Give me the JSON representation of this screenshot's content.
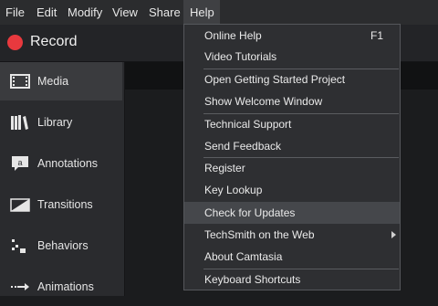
{
  "menubar": {
    "file": "File",
    "edit": "Edit",
    "modify": "Modify",
    "view": "View",
    "share": "Share",
    "help": "Help"
  },
  "toolbar": {
    "record_label": "Record"
  },
  "sidebar": {
    "items": [
      {
        "label": "Media",
        "icon": "film-icon"
      },
      {
        "label": "Library",
        "icon": "books-icon"
      },
      {
        "label": "Annotations",
        "icon": "annotation-icon"
      },
      {
        "label": "Transitions",
        "icon": "transition-icon"
      },
      {
        "label": "Behaviors",
        "icon": "behaviors-icon"
      },
      {
        "label": "Animations",
        "icon": "animation-arrow-icon"
      }
    ]
  },
  "help_menu": {
    "items": [
      {
        "label": "Online Help",
        "shortcut": "F1"
      },
      {
        "label": "Video Tutorials"
      },
      {
        "label": "Open Getting Started Project"
      },
      {
        "label": "Show Welcome Window"
      },
      {
        "label": "Technical Support"
      },
      {
        "label": "Send Feedback"
      },
      {
        "label": "Register"
      },
      {
        "label": "Key Lookup"
      },
      {
        "label": "Check for Updates"
      },
      {
        "label": "TechSmith on the Web"
      },
      {
        "label": "About Camtasia"
      },
      {
        "label": "Keyboard Shortcuts"
      }
    ]
  },
  "colors": {
    "record": "#e8393e",
    "menu_bg": "#2e2f32",
    "highlight": "#45474b"
  }
}
